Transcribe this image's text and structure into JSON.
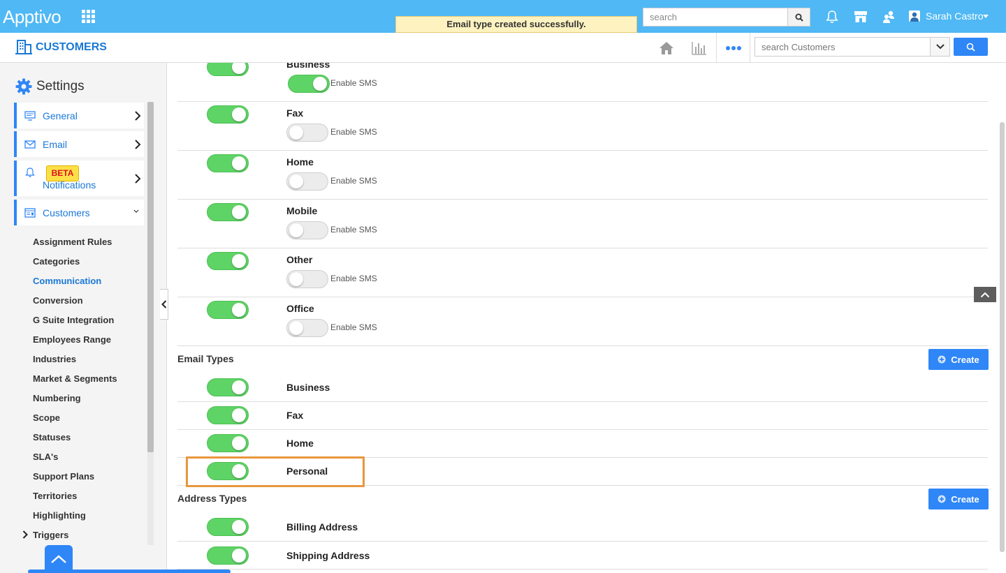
{
  "topbar": {
    "logo": "Apptivo",
    "search_placeholder": "search",
    "user_name": "Sarah Castro"
  },
  "app": {
    "title": "CUSTOMERS",
    "search_placeholder": "search Customers"
  },
  "toast": "Email type created successfully.",
  "sidebar": {
    "heading": "Settings",
    "nav": [
      {
        "label": "General",
        "icon": "monitor-icon"
      },
      {
        "label": "Email",
        "icon": "envelope-icon"
      },
      {
        "label": "Notifications",
        "icon": "bell-icon",
        "badge": "BETA"
      },
      {
        "label": "Customers",
        "icon": "customers-icon"
      }
    ],
    "sub_items": [
      "Assignment Rules",
      "Categories",
      "Communication",
      "Conversion",
      "G Suite Integration",
      "Employees Range",
      "Industries",
      "Market & Segments",
      "Numbering",
      "Scope",
      "Statuses",
      "SLA's",
      "Support Plans",
      "Territories",
      "Highlighting",
      "Triggers"
    ],
    "active_sub_item": "Communication"
  },
  "phone_types": [
    {
      "name": "Business",
      "enabled": true,
      "sms_enabled": true,
      "sms_label": "Enable SMS"
    },
    {
      "name": "Fax",
      "enabled": true,
      "sms_enabled": false,
      "sms_label": "Enable SMS"
    },
    {
      "name": "Home",
      "enabled": true,
      "sms_enabled": false,
      "sms_label": "Enable SMS"
    },
    {
      "name": "Mobile",
      "enabled": true,
      "sms_enabled": false,
      "sms_label": "Enable SMS"
    },
    {
      "name": "Other",
      "enabled": true,
      "sms_enabled": false,
      "sms_label": "Enable SMS"
    },
    {
      "name": "Office",
      "enabled": true,
      "sms_enabled": false,
      "sms_label": "Enable SMS"
    }
  ],
  "email_types": {
    "title": "Email Types",
    "create_label": "Create",
    "items": [
      {
        "name": "Business",
        "enabled": true
      },
      {
        "name": "Fax",
        "enabled": true
      },
      {
        "name": "Home",
        "enabled": true
      },
      {
        "name": "Personal",
        "enabled": true
      }
    ]
  },
  "address_types": {
    "title": "Address Types",
    "create_label": "Create",
    "items": [
      {
        "name": "Billing Address",
        "enabled": true
      },
      {
        "name": "Shipping Address",
        "enabled": true
      }
    ]
  },
  "colors": {
    "topbar": "#4fb8f5",
    "accent": "#2f86f6",
    "toggle_on": "#5fd466",
    "highlight": "#e8973d"
  }
}
